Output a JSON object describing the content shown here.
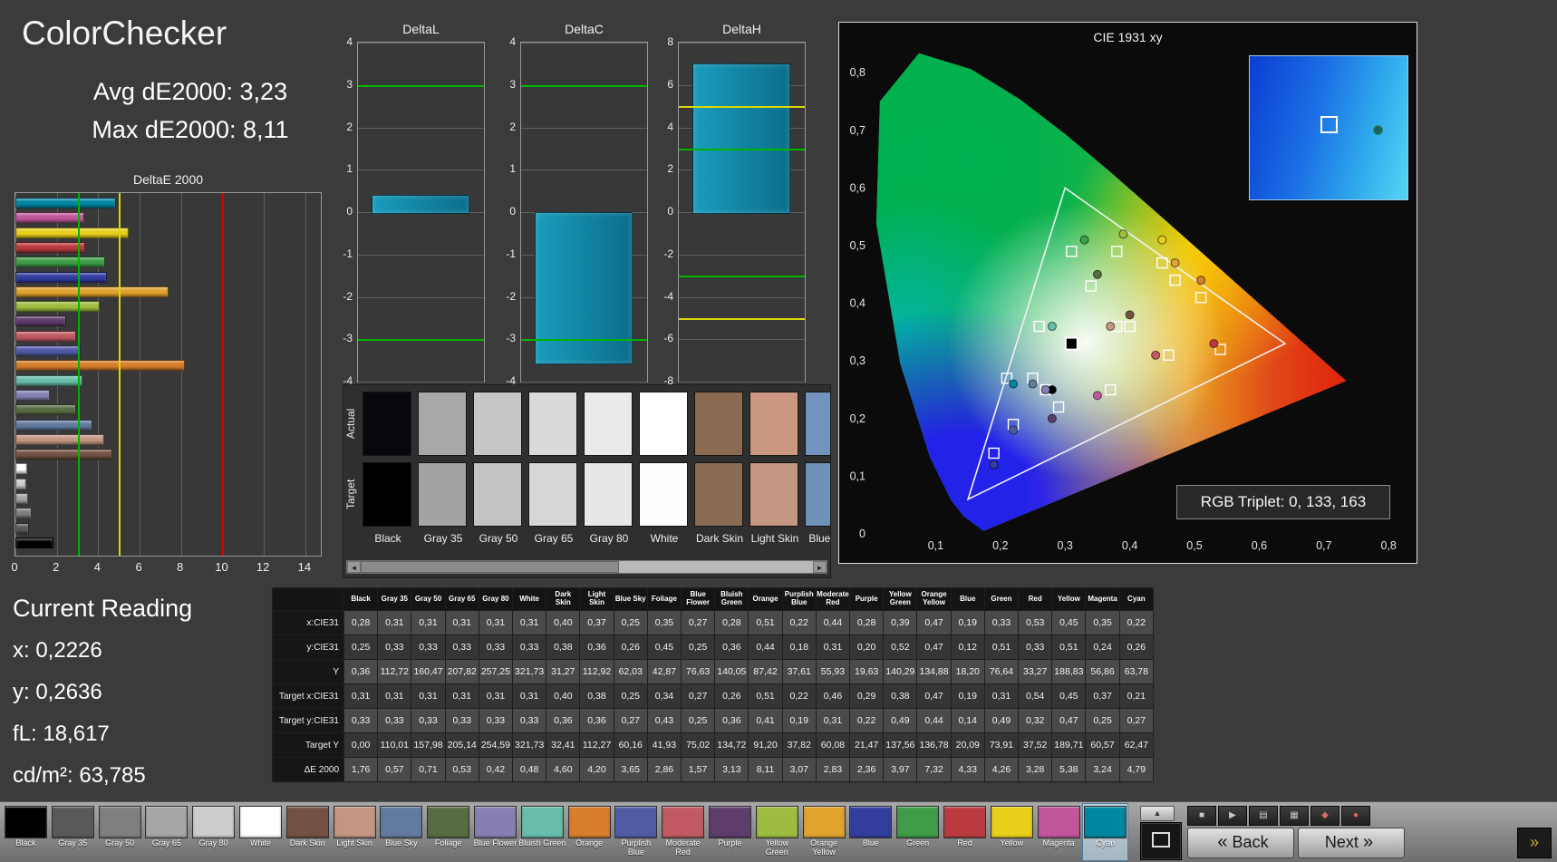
{
  "header": {
    "title": "ColorChecker",
    "avg_label": "Avg dE2000: 3,23",
    "max_label": "Max dE2000: 8,11"
  },
  "current_reading": {
    "title": "Current Reading",
    "x": "x: 0,2226",
    "y": "y: 0,2636",
    "fl": "fL: 18,617",
    "cdm2": "cd/m²: 63,785"
  },
  "patches": [
    {
      "name": "Black",
      "color": "#000000"
    },
    {
      "name": "Gray 35",
      "color": "#595959"
    },
    {
      "name": "Gray 50",
      "color": "#7f7f7f"
    },
    {
      "name": "Gray 65",
      "color": "#a6a6a6"
    },
    {
      "name": "Gray 80",
      "color": "#cccccc"
    },
    {
      "name": "White",
      "color": "#ffffff"
    },
    {
      "name": "Dark Skin",
      "color": "#735244"
    },
    {
      "name": "Light Skin",
      "color": "#c29682"
    },
    {
      "name": "Blue Sky",
      "color": "#627a9d"
    },
    {
      "name": "Foliage",
      "color": "#576c43"
    },
    {
      "name": "Blue Flower",
      "color": "#8580b1"
    },
    {
      "name": "Bluish Green",
      "color": "#67bdaa"
    },
    {
      "name": "Orange",
      "color": "#d67e2c"
    },
    {
      "name": "Purplish Blue",
      "color": "#505ba6"
    },
    {
      "name": "Moderate Red",
      "color": "#c15a63"
    },
    {
      "name": "Purple",
      "color": "#5e3c6c"
    },
    {
      "name": "Yellow Green",
      "color": "#9dbc40"
    },
    {
      "name": "Orange Yellow",
      "color": "#e0a32e"
    },
    {
      "name": "Blue",
      "color": "#333d9e"
    },
    {
      "name": "Green",
      "color": "#3f9d47"
    },
    {
      "name": "Red",
      "color": "#bb3a3f"
    },
    {
      "name": "Yellow",
      "color": "#e8cf1a"
    },
    {
      "name": "Magenta",
      "color": "#c1569b"
    },
    {
      "name": "Cyan",
      "color": "#0085a3"
    }
  ],
  "chart_data": [
    {
      "type": "bar",
      "title": "DeltaE 2000",
      "orientation": "horizontal",
      "categories": [
        "Cyan",
        "Magenta",
        "Yellow",
        "Red",
        "Green",
        "Blue",
        "Orange Yellow",
        "Yellow Green",
        "Purple",
        "Moderate Red",
        "Purplish Blue",
        "Orange",
        "Bluish Green",
        "Blue Flower",
        "Foliage",
        "Blue Sky",
        "Light Skin",
        "Dark Skin",
        "White",
        "Gray 80",
        "Gray 65",
        "Gray 50",
        "Gray 35",
        "Black"
      ],
      "values": [
        4.79,
        3.24,
        5.38,
        3.28,
        4.26,
        4.33,
        7.32,
        3.97,
        2.36,
        2.83,
        3.07,
        8.11,
        3.13,
        1.57,
        2.86,
        3.65,
        4.2,
        4.6,
        0.48,
        0.42,
        0.53,
        0.71,
        0.57,
        1.76
      ],
      "xlim": [
        0,
        14.75
      ],
      "xticks": [
        0,
        2,
        4,
        6,
        8,
        10,
        12,
        14
      ],
      "reference_lines": [
        {
          "value": 3,
          "color": "#00b400"
        },
        {
          "value": 5,
          "color": "#d8d800"
        },
        {
          "value": 10,
          "color": "#dc0000"
        }
      ]
    },
    {
      "type": "bar",
      "title": "DeltaL",
      "values": [
        0.4
      ],
      "ylim": [
        -4,
        4
      ],
      "yticks": [
        "4",
        "3",
        "2",
        "1",
        "0",
        "-1",
        "-2",
        "-3",
        "-4"
      ],
      "reference_lines": [
        {
          "value": 3,
          "color": "#00b400"
        },
        {
          "value": -3,
          "color": "#00b400"
        }
      ]
    },
    {
      "type": "bar",
      "title": "DeltaC",
      "values": [
        -3.55
      ],
      "ylim": [
        -4,
        4
      ],
      "yticks": [
        "4",
        "3",
        "2",
        "1",
        "0",
        "-1",
        "-2",
        "-3",
        "-4"
      ],
      "reference_lines": [
        {
          "value": 3,
          "color": "#00b400"
        },
        {
          "value": -3,
          "color": "#00b400"
        }
      ]
    },
    {
      "type": "bar",
      "title": "DeltaH",
      "values": [
        7.0
      ],
      "ylim": [
        -8,
        8
      ],
      "yticks": [
        "8",
        "6",
        "4",
        "2",
        "0",
        "-2",
        "-4",
        "-6",
        "-8"
      ],
      "reference_lines": [
        {
          "value": 5,
          "color": "#d8d800"
        },
        {
          "value": 3,
          "color": "#00b400"
        },
        {
          "value": -3,
          "color": "#00b400"
        },
        {
          "value": -5,
          "color": "#d8d800"
        }
      ]
    },
    {
      "type": "scatter",
      "title": "CIE 1931 xy",
      "xlim": [
        0,
        0.8
      ],
      "ylim": [
        0,
        0.8
      ],
      "xtick_labels": [
        "0",
        "0,1",
        "0,2",
        "0,3",
        "0,4",
        "0,5",
        "0,6",
        "0,7",
        "0,8"
      ],
      "ytick_labels": [
        "0,8",
        "0,7",
        "0,6",
        "0,5",
        "0,4",
        "0,3",
        "0,2",
        "0,1",
        "0"
      ],
      "gamut_triangle": [
        [
          0.64,
          0.33
        ],
        [
          0.3,
          0.6
        ],
        [
          0.15,
          0.06
        ]
      ],
      "highlight": {
        "x": 0.31,
        "y": 0.33
      },
      "measured": [
        [
          0.28,
          0.25
        ],
        [
          0.31,
          0.33
        ],
        [
          0.31,
          0.33
        ],
        [
          0.31,
          0.33
        ],
        [
          0.31,
          0.33
        ],
        [
          0.31,
          0.33
        ],
        [
          0.4,
          0.38
        ],
        [
          0.37,
          0.36
        ],
        [
          0.25,
          0.26
        ],
        [
          0.35,
          0.45
        ],
        [
          0.27,
          0.25
        ],
        [
          0.28,
          0.36
        ],
        [
          0.51,
          0.44
        ],
        [
          0.22,
          0.18
        ],
        [
          0.44,
          0.31
        ],
        [
          0.28,
          0.2
        ],
        [
          0.39,
          0.52
        ],
        [
          0.47,
          0.47
        ],
        [
          0.19,
          0.12
        ],
        [
          0.33,
          0.51
        ],
        [
          0.53,
          0.33
        ],
        [
          0.45,
          0.51
        ],
        [
          0.35,
          0.24
        ],
        [
          0.22,
          0.26
        ]
      ],
      "target": [
        [
          0.31,
          0.33
        ],
        [
          0.31,
          0.33
        ],
        [
          0.31,
          0.33
        ],
        [
          0.31,
          0.33
        ],
        [
          0.31,
          0.33
        ],
        [
          0.31,
          0.33
        ],
        [
          0.4,
          0.36
        ],
        [
          0.38,
          0.36
        ],
        [
          0.25,
          0.27
        ],
        [
          0.34,
          0.43
        ],
        [
          0.27,
          0.25
        ],
        [
          0.26,
          0.36
        ],
        [
          0.51,
          0.41
        ],
        [
          0.22,
          0.19
        ],
        [
          0.46,
          0.31
        ],
        [
          0.29,
          0.22
        ],
        [
          0.38,
          0.49
        ],
        [
          0.47,
          0.44
        ],
        [
          0.19,
          0.14
        ],
        [
          0.31,
          0.49
        ],
        [
          0.54,
          0.32
        ],
        [
          0.45,
          0.47
        ],
        [
          0.37,
          0.25
        ],
        [
          0.21,
          0.27
        ]
      ]
    }
  ],
  "cie_panel": {
    "rgb_triplet": "RGB Triplet: 0, 133, 163"
  },
  "swatch_panel": {
    "row_labels": [
      "Actual",
      "Target"
    ],
    "items": [
      {
        "name": "Black",
        "actual": "#07070d",
        "target": "#000000"
      },
      {
        "name": "Gray 35",
        "actual": "#a8a8a8",
        "target": "#a3a3a3"
      },
      {
        "name": "Gray 50",
        "actual": "#c7c7c7",
        "target": "#c3c3c3"
      },
      {
        "name": "Gray 65",
        "actual": "#dadada",
        "target": "#d7d7d7"
      },
      {
        "name": "Gray 80",
        "actual": "#eaeaea",
        "target": "#e7e7e7"
      },
      {
        "name": "White",
        "actual": "#ffffff",
        "target": "#fdfdfd"
      },
      {
        "name": "Dark Skin",
        "actual": "#8a6a51",
        "target": "#8a6c55"
      },
      {
        "name": "Light Skin",
        "actual": "#cb9780",
        "target": "#c49780"
      },
      {
        "name": "Blue Sky",
        "actual": "#7193bd",
        "target": "#6f90b7"
      }
    ]
  },
  "table": {
    "columns": [
      "Black",
      "Gray 35",
      "Gray 50",
      "Gray 65",
      "Gray 80",
      "White",
      "Dark Skin",
      "Light Skin",
      "Blue Sky",
      "Foliage",
      "Blue Flower",
      "Bluish Green",
      "Orange",
      "Purplish Blue",
      "Moderate Red",
      "Purple",
      "Yellow Green",
      "Orange Yellow",
      "Blue",
      "Green",
      "Red",
      "Yellow",
      "Magenta",
      "Cyan"
    ],
    "rows": [
      {
        "label": "x:CIE31",
        "values": [
          "0,28",
          "0,31",
          "0,31",
          "0,31",
          "0,31",
          "0,31",
          "0,40",
          "0,37",
          "0,25",
          "0,35",
          "0,27",
          "0,28",
          "0,51",
          "0,22",
          "0,44",
          "0,28",
          "0,39",
          "0,47",
          "0,19",
          "0,33",
          "0,53",
          "0,45",
          "0,35",
          "0,22"
        ]
      },
      {
        "label": "y:CIE31",
        "values": [
          "0,25",
          "0,33",
          "0,33",
          "0,33",
          "0,33",
          "0,33",
          "0,38",
          "0,36",
          "0,26",
          "0,45",
          "0,25",
          "0,36",
          "0,44",
          "0,18",
          "0,31",
          "0,20",
          "0,52",
          "0,47",
          "0,12",
          "0,51",
          "0,33",
          "0,51",
          "0,24",
          "0,26"
        ]
      },
      {
        "label": "Y",
        "values": [
          "0,36",
          "112,72",
          "160,47",
          "207,82",
          "257,25",
          "321,73",
          "31,27",
          "112,92",
          "62,03",
          "42,87",
          "76,63",
          "140,05",
          "87,42",
          "37,61",
          "55,93",
          "19,63",
          "140,29",
          "134,88",
          "18,20",
          "76,64",
          "33,27",
          "188,83",
          "56,86",
          "63,78"
        ]
      },
      {
        "label": "Target x:CIE31",
        "values": [
          "0,31",
          "0,31",
          "0,31",
          "0,31",
          "0,31",
          "0,31",
          "0,40",
          "0,38",
          "0,25",
          "0,34",
          "0,27",
          "0,26",
          "0,51",
          "0,22",
          "0,46",
          "0,29",
          "0,38",
          "0,47",
          "0,19",
          "0,31",
          "0,54",
          "0,45",
          "0,37",
          "0,21"
        ]
      },
      {
        "label": "Target y:CIE31",
        "values": [
          "0,33",
          "0,33",
          "0,33",
          "0,33",
          "0,33",
          "0,33",
          "0,36",
          "0,36",
          "0,27",
          "0,43",
          "0,25",
          "0,36",
          "0,41",
          "0,19",
          "0,31",
          "0,22",
          "0,49",
          "0,44",
          "0,14",
          "0,49",
          "0,32",
          "0,47",
          "0,25",
          "0,27"
        ]
      },
      {
        "label": "Target Y",
        "values": [
          "0,00",
          "110,01",
          "157,98",
          "205,14",
          "254,59",
          "321,73",
          "32,41",
          "112,27",
          "60,16",
          "41,93",
          "75,02",
          "134,72",
          "91,20",
          "37,82",
          "60,08",
          "21,47",
          "137,56",
          "136,78",
          "20,09",
          "73,91",
          "37,52",
          "189,71",
          "60,57",
          "62,47"
        ]
      },
      {
        "label": "ΔE 2000",
        "values": [
          "1,76",
          "0,57",
          "0,71",
          "0,53",
          "0,42",
          "0,48",
          "4,60",
          "4,20",
          "3,65",
          "2,86",
          "1,57",
          "3,13",
          "8,11",
          "3,07",
          "2,83",
          "2,36",
          "3,97",
          "7,32",
          "4,33",
          "4,26",
          "3,28",
          "5,38",
          "3,24",
          "4,79"
        ]
      }
    ]
  },
  "toolbar": {
    "selected": "Cyan",
    "back": "Back",
    "next": "Next"
  },
  "icons": {
    "up": "▲",
    "stop": "■",
    "play": "▶",
    "film": "▤",
    "grid": "▦",
    "marker": "◆",
    "record": "●",
    "back_chevron": "«",
    "next_chevron": "»",
    "fast_forward": "»",
    "scroll_left": "◄",
    "scroll_right": "►"
  }
}
